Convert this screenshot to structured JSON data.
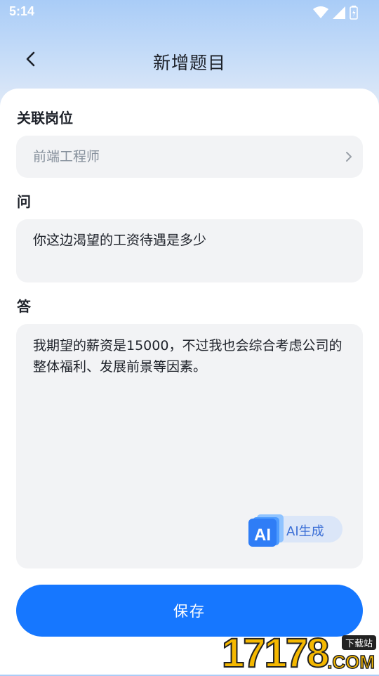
{
  "status_bar": {
    "time": "5:14"
  },
  "header": {
    "title": "新增题目"
  },
  "form": {
    "position_label": "关联岗位",
    "position_value": "前端工程师",
    "question_label": "问",
    "question_value": "你这边渴望的工资待遇是多少",
    "answer_label": "答",
    "answer_value": "我期望的薪资是15000，不过我也会综合考虑公司的整体福利、发展前景等因素。",
    "ai_button": {
      "badge": "AI",
      "label": "AI生成"
    }
  },
  "save_button": {
    "label": "保存"
  },
  "watermark": {
    "digits": "17178",
    "tag": "下载站",
    "domain": ".COM"
  },
  "colors": {
    "primary": "#1677ff",
    "field_bg": "#f2f3f5",
    "header_gradient_top": "#a9ccf7",
    "ai_accent": "#3b6fd6"
  }
}
